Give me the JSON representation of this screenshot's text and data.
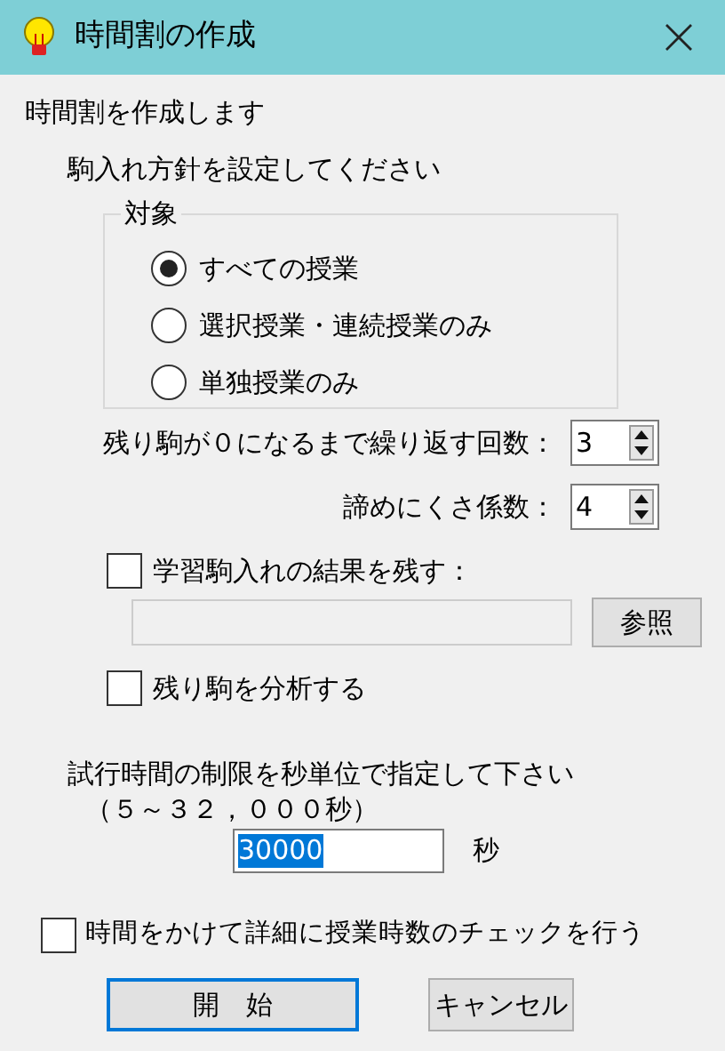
{
  "window": {
    "title": "時間割の作成"
  },
  "intro": "時間割を作成します",
  "policy": {
    "heading": "駒入れ方針を設定してください",
    "target": {
      "legend": "対象",
      "options": [
        {
          "label": "すべての授業",
          "selected": true
        },
        {
          "label": "選択授業・連続授業のみ",
          "selected": false
        },
        {
          "label": "単独授業のみ",
          "selected": false
        }
      ]
    },
    "spinners": [
      {
        "label": "残り駒が０になるまで繰り返す回数：",
        "value": "3"
      },
      {
        "label": "諦めにくさ係数：",
        "value": "4"
      }
    ],
    "save_learning": {
      "label": "学習駒入れの結果を残す：",
      "checked": false,
      "path": {
        "disabled": true
      },
      "browse_button": "参照"
    },
    "analyze": {
      "label": "残り駒を分析する",
      "checked": false
    }
  },
  "time_limit": {
    "prompt": "試行時間の制限を秒単位で指定して下さい",
    "range": "（５～３２，０００秒）",
    "value": "30000",
    "text_selected": true,
    "unit": "秒"
  },
  "detail_check": {
    "label": "時間をかけて詳細に授業時数のチェックを行う",
    "checked": false
  },
  "buttons": [
    {
      "label": "開　始",
      "default": true
    },
    {
      "label": "キャンセル",
      "default": false
    }
  ]
}
